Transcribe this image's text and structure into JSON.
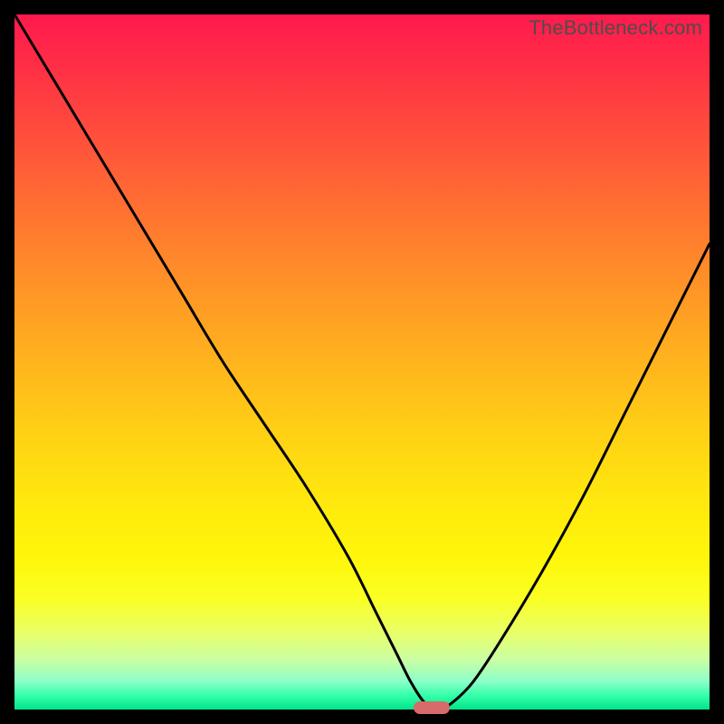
{
  "watermark": "TheBottleneck.com",
  "chart_data": {
    "type": "line",
    "title": "",
    "xlabel": "",
    "ylabel": "",
    "xlim": [
      0,
      100
    ],
    "ylim": [
      0,
      100
    ],
    "grid": false,
    "legend": false,
    "background_gradient_stops": [
      {
        "pos": 0,
        "color": "#ff1a4d"
      },
      {
        "pos": 50,
        "color": "#ffd015"
      },
      {
        "pos": 85,
        "color": "#fff60a"
      },
      {
        "pos": 100,
        "color": "#00e58a"
      }
    ],
    "series": [
      {
        "name": "bottleneck-curve",
        "x": [
          0,
          6,
          12,
          18,
          24,
          30,
          36,
          42,
          48,
          52,
          55,
          57,
          59,
          61,
          63,
          66,
          70,
          76,
          82,
          88,
          94,
          100
        ],
        "values": [
          100,
          90,
          80,
          70,
          60,
          50,
          41,
          32,
          22,
          14,
          8,
          4,
          1,
          0,
          1,
          4,
          10,
          20,
          31,
          43,
          55,
          67
        ]
      }
    ],
    "marker": {
      "x": 60,
      "y": 0,
      "width_pct": 5.2,
      "color": "#d76a6a"
    }
  }
}
